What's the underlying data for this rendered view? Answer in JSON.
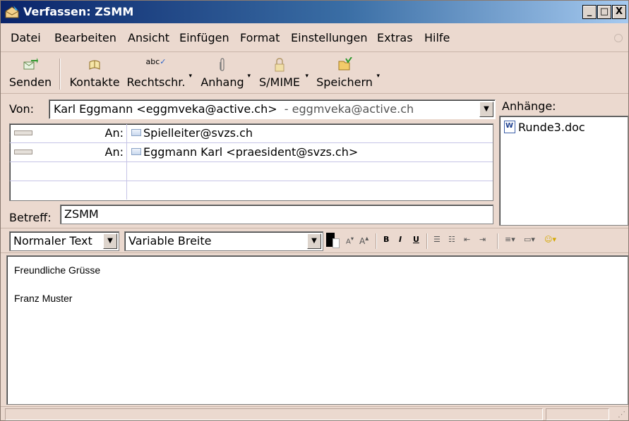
{
  "window": {
    "title": "Verfassen: ZSMM",
    "minimize": "_",
    "maximize": "□",
    "close": "X"
  },
  "menu": [
    "Datei",
    "Bearbeiten",
    "Ansicht",
    "Einfügen",
    "Format",
    "Einstellungen",
    "Extras",
    "Hilfe"
  ],
  "toolbar": {
    "send": "Senden",
    "contacts": "Kontakte",
    "spell": "Rechtschr.",
    "attach": "Anhang",
    "smime": "S/MIME",
    "save": "Speichern",
    "spell_icon_text": "abc"
  },
  "from": {
    "label": "Von:",
    "value": "Karl Eggmann <eggmveka@active.ch>",
    "account": "- eggmveka@active.ch"
  },
  "recipients": [
    {
      "type": "An:",
      "address": "Spielleiter@svzs.ch"
    },
    {
      "type": "An:",
      "address": "Eggmann Karl <praesident@svzs.ch>"
    }
  ],
  "subject": {
    "label": "Betreff:",
    "value": "ZSMM"
  },
  "attachments": {
    "label": "Anhänge:",
    "items": [
      "Runde3.doc"
    ]
  },
  "format": {
    "paragraph_style": "Normaler Text",
    "font": "Variable Breite"
  },
  "body": {
    "line1": "Freundliche Grüsse",
    "line2": "Franz Muster"
  },
  "colors": {
    "window_bg": "#ebd9cf",
    "title_start": "#0a246a",
    "title_end": "#a6caf0"
  }
}
